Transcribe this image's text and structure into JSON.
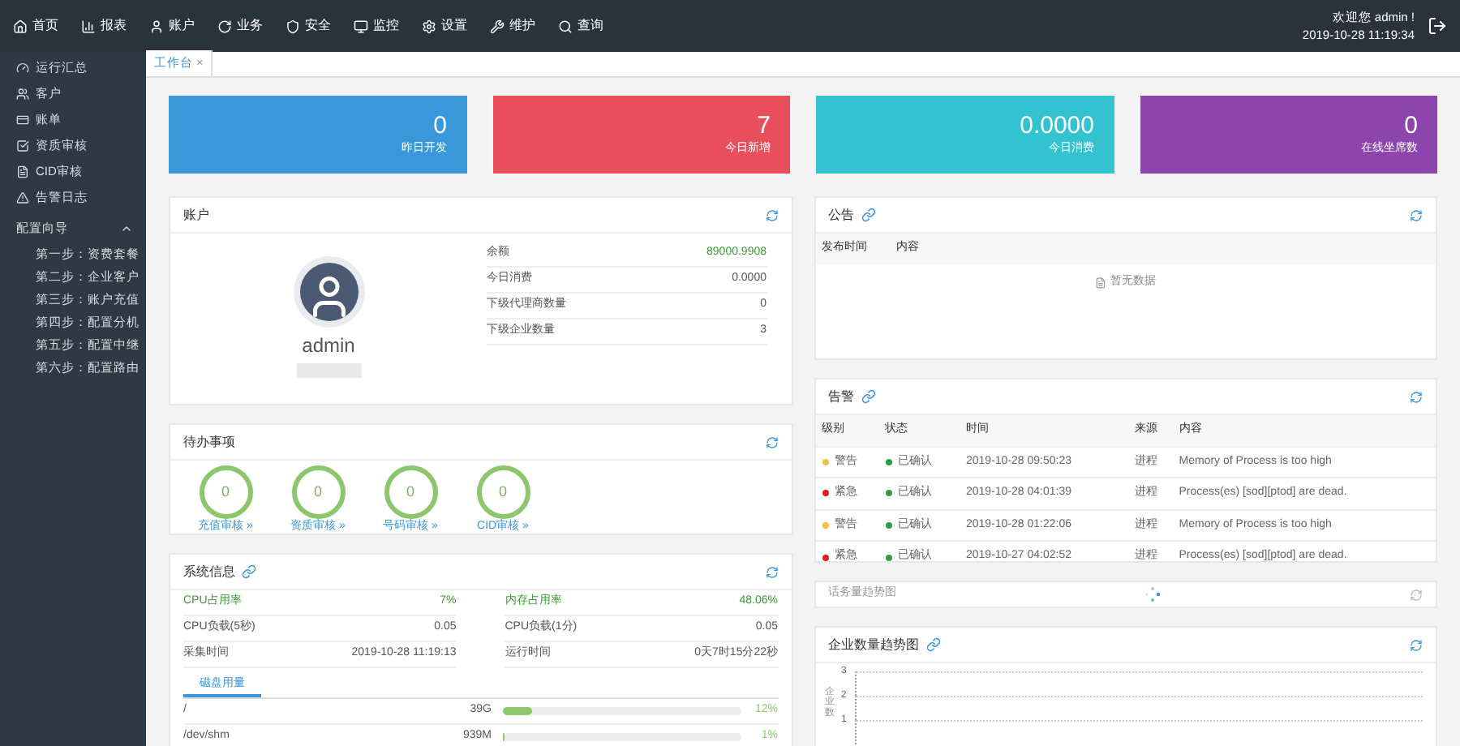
{
  "topnav": {
    "items": [
      "首页",
      "报表",
      "账户",
      "业务",
      "安全",
      "监控",
      "设置",
      "维护",
      "查询"
    ],
    "welcome": "欢迎您 admin !",
    "datetime": "2019-10-28 11:19:34"
  },
  "sidebar": {
    "items": [
      {
        "label": "运行汇总"
      },
      {
        "label": "客户"
      },
      {
        "label": "账单"
      },
      {
        "label": "资质审核"
      },
      {
        "label": "CID审核"
      },
      {
        "label": "告警日志"
      }
    ],
    "group": {
      "label": "配置向导",
      "expanded": true,
      "children": [
        "第一步：资费套餐",
        "第二步：企业客户",
        "第三步：账户充值",
        "第四步：配置分机",
        "第五步：配置中继",
        "第六步：配置路由"
      ]
    }
  },
  "tabs": [
    {
      "label": "工作台",
      "selected": true,
      "close": "×"
    }
  ],
  "stats": [
    {
      "value": "0",
      "label": "昨日开发",
      "color": "#3a97da"
    },
    {
      "value": "7",
      "label": "今日新增",
      "color": "#e84e5b"
    },
    {
      "value": "0.0000",
      "label": "今日消费",
      "color": "#33c3d0"
    },
    {
      "value": "0",
      "label": "在线坐席数",
      "color": "#8e44ad"
    }
  ],
  "account": {
    "title": "账户",
    "username": "admin",
    "rows": [
      {
        "label": "余额",
        "value": "89000.9908",
        "highlight": true
      },
      {
        "label": "今日消费",
        "value": "0.0000",
        "highlight": false
      },
      {
        "label": "下级代理商数量",
        "value": "0",
        "highlight": false
      },
      {
        "label": "下级企业数量",
        "value": "3",
        "highlight": false
      }
    ]
  },
  "todo": {
    "title": "待办事项",
    "items": [
      {
        "count": "0",
        "label": "充值审核 »"
      },
      {
        "count": "0",
        "label": "资质审核 »"
      },
      {
        "count": "0",
        "label": "号码审核 »"
      },
      {
        "count": "0",
        "label": "CID审核 »"
      }
    ]
  },
  "system": {
    "title": "系统信息",
    "stats": [
      {
        "label": "CPU占用率",
        "value": "7%",
        "highlight": true
      },
      {
        "label": "内存占用率",
        "value": "48.06%",
        "highlight": true
      },
      {
        "label": "CPU负载(5秒)",
        "value": "0.05",
        "highlight": false
      },
      {
        "label": "CPU负载(1分)",
        "value": "0.05",
        "highlight": false
      },
      {
        "label": "采集时间",
        "value": "2019-10-28 11:19:13",
        "highlight": false
      },
      {
        "label": "运行时间",
        "value": "0天7时15分22秒",
        "highlight": false
      }
    ],
    "tab": "磁盘用量",
    "disks": [
      {
        "mount": "/",
        "size": "39G",
        "level": 0.12,
        "reading": "12%"
      },
      {
        "mount": "/dev/shm",
        "size": "939M",
        "level": 0.01,
        "reading": "1%"
      }
    ]
  },
  "notice": {
    "title": "公告",
    "columns": [
      "发布时间",
      "内容"
    ],
    "empty": "暂无数据"
  },
  "alerts": {
    "title": "告警",
    "columns": [
      "级别",
      "状态",
      "时间",
      "来源",
      "内容"
    ],
    "rows": [
      {
        "level": "警告",
        "color": "#f0c040",
        "status": "已确认",
        "time": "2019-10-28 09:50:23",
        "source": "进程",
        "content": "Memory of Process is too high"
      },
      {
        "level": "紧急",
        "color": "#e02020",
        "status": "已确认",
        "time": "2019-10-28 04:01:39",
        "source": "进程",
        "content": "Process(es) [sod][ptod] are dead."
      },
      {
        "level": "警告",
        "color": "#f0c040",
        "status": "已确认",
        "time": "2019-10-28 01:22:06",
        "source": "进程",
        "content": "Memory of Process is too high"
      },
      {
        "level": "紧急",
        "color": "#e02020",
        "status": "已确认",
        "time": "2019-10-27 04:02:52",
        "source": "进程",
        "content": "Process(es) [sod][ptod] are dead."
      }
    ]
  },
  "traffic": {
    "title": "话务量趋势图"
  },
  "enterprise": {
    "title": "企业数量趋势图",
    "ylabel": "企业数",
    "yticks": [
      "3",
      "2",
      "1"
    ]
  }
}
